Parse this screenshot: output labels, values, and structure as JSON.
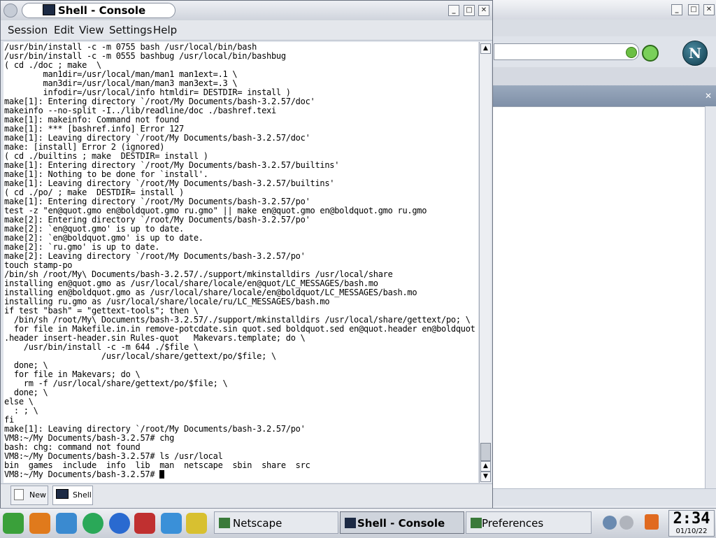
{
  "console_window": {
    "title": "Shell - Console",
    "menu": [
      "Session",
      "Edit",
      "View",
      "Settings",
      "Help"
    ],
    "terminal_lines": [
      "/usr/bin/install -c -m 0755 bash /usr/local/bin/bash",
      "/usr/bin/install -c -m 0555 bashbug /usr/local/bin/bashbug",
      "( cd ./doc ; make  \\",
      "        man1dir=/usr/local/man/man1 man1ext=.1 \\",
      "        man3dir=/usr/local/man/man3 man3ext=.3 \\",
      "        infodir=/usr/local/info htmldir= DESTDIR= install )",
      "make[1]: Entering directory `/root/My Documents/bash-3.2.57/doc'",
      "makeinfo --no-split -I../lib/readline/doc ./bashref.texi",
      "make[1]: makeinfo: Command not found",
      "make[1]: *** [bashref.info] Error 127",
      "make[1]: Leaving directory `/root/My Documents/bash-3.2.57/doc'",
      "make: [install] Error 2 (ignored)",
      "( cd ./builtins ; make  DESTDIR= install )",
      "make[1]: Entering directory `/root/My Documents/bash-3.2.57/builtins'",
      "make[1]: Nothing to be done for `install'.",
      "make[1]: Leaving directory `/root/My Documents/bash-3.2.57/builtins'",
      "( cd ./po/ ; make  DESTDIR= install )",
      "make[1]: Entering directory `/root/My Documents/bash-3.2.57/po'",
      "test -z \"en@quot.gmo en@boldquot.gmo ru.gmo\" || make en@quot.gmo en@boldquot.gmo ru.gmo",
      "make[2]: Entering directory `/root/My Documents/bash-3.2.57/po'",
      "make[2]: `en@quot.gmo' is up to date.",
      "make[2]: `en@boldquot.gmo' is up to date.",
      "make[2]: `ru.gmo' is up to date.",
      "make[2]: Leaving directory `/root/My Documents/bash-3.2.57/po'",
      "touch stamp-po",
      "/bin/sh /root/My\\ Documents/bash-3.2.57/./support/mkinstalldirs /usr/local/share",
      "installing en@quot.gmo as /usr/local/share/locale/en@quot/LC_MESSAGES/bash.mo",
      "installing en@boldquot.gmo as /usr/local/share/locale/en@boldquot/LC_MESSAGES/bash.mo",
      "installing ru.gmo as /usr/local/share/locale/ru/LC_MESSAGES/bash.mo",
      "if test \"bash\" = \"gettext-tools\"; then \\",
      "  /bin/sh /root/My\\ Documents/bash-3.2.57/./support/mkinstalldirs /usr/local/share/gettext/po; \\",
      "  for file in Makefile.in.in remove-potcdate.sin quot.sed boldquot.sed en@quot.header en@boldquot",
      ".header insert-header.sin Rules-quot   Makevars.template; do \\",
      "    /usr/bin/install -c -m 644 ./$file \\",
      "                    /usr/local/share/gettext/po/$file; \\",
      "  done; \\",
      "  for file in Makevars; do \\",
      "    rm -f /usr/local/share/gettext/po/$file; \\",
      "  done; \\",
      "else \\",
      "  : ; \\",
      "fi",
      "make[1]: Leaving directory `/root/My Documents/bash-3.2.57/po'",
      "VM8:~/My Documents/bash-3.2.57# chg",
      "bash: chg: command not found",
      "VM8:~/My Documents/bash-3.2.57# ls /usr/local",
      "bin  games  include  info  lib  man  netscape  sbin  share  src",
      "VM8:~/My Documents/bash-3.2.57# "
    ],
    "tabs": [
      {
        "label": "New"
      },
      {
        "label": "Shell"
      }
    ]
  },
  "taskbar": {
    "tasks": [
      {
        "label": "Netscape",
        "active": false
      },
      {
        "label": "Shell - Console",
        "active": true
      },
      {
        "label": "Preferences",
        "active": false
      }
    ],
    "clock": {
      "time": "2:34",
      "date": "01/10/22"
    }
  },
  "browser_window": {
    "logo_letter": "N"
  },
  "colors": {
    "terminal_bg": "#ffffff",
    "terminal_fg": "#000000",
    "accent": "#1c2a44"
  }
}
